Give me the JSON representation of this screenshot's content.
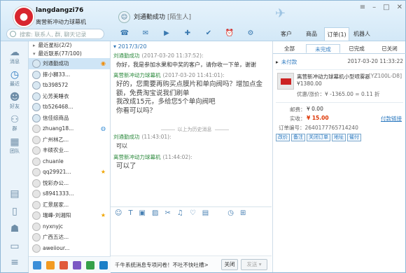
{
  "header": {
    "username": "langdangzi76",
    "shop_name": "离营新冲动力球幕机",
    "search_placeholder": "搜索: 联系人, 群, 聊天记录",
    "contact_name": "刘通勤成功",
    "contact_tag": "[陌生人]",
    "right_tabs": [
      {
        "label": "客户"
      },
      {
        "label": "商品"
      },
      {
        "label": "订单(1)"
      },
      {
        "label": "机器人"
      }
    ]
  },
  "rail": [
    {
      "label": "消息",
      "icon": "message-icon"
    },
    {
      "label": "最近",
      "icon": "clock-icon"
    },
    {
      "label": "好友",
      "icon": "person-icon"
    },
    {
      "label": "群",
      "icon": "group-icon"
    },
    {
      "label": "团队",
      "icon": "team-icon"
    }
  ],
  "contacts": {
    "groups": [
      {
        "label": "最近星标(2/2)"
      },
      {
        "label": "最近联系(77/100)"
      }
    ],
    "items": [
      {
        "name": "刘通勤成功",
        "online": true,
        "selected": true,
        "mark": "warn"
      },
      {
        "name": "摔小狮33...",
        "online": true,
        "mark": ""
      },
      {
        "name": "tb398572",
        "online": true,
        "mark": ""
      },
      {
        "name": "沁芳美睡衣",
        "online": true,
        "mark": ""
      },
      {
        "name": "tb526468...",
        "online": true,
        "mark": ""
      },
      {
        "name": "信佳综商品",
        "online": true,
        "mark": ""
      },
      {
        "name": "zhuang18...",
        "online": false,
        "mark": "globe"
      },
      {
        "name": "广州林乙...",
        "online": false,
        "mark": ""
      },
      {
        "name": "丰硕农业...",
        "online": false,
        "mark": ""
      },
      {
        "name": "chuanle",
        "online": false,
        "mark": ""
      },
      {
        "name": "qq29921...",
        "online": false,
        "mark": "star"
      },
      {
        "name": "悦彩办公...",
        "online": false,
        "mark": ""
      },
      {
        "name": "s8941333...",
        "online": false,
        "mark": ""
      },
      {
        "name": "汇景居家...",
        "online": false,
        "mark": ""
      },
      {
        "name": "瑞峰-刘湘阳",
        "online": false,
        "mark": "star"
      },
      {
        "name": "nyxnyjc",
        "online": false,
        "mark": ""
      },
      {
        "name": "广西五达...",
        "online": false,
        "mark": ""
      },
      {
        "name": "aweiiour...",
        "online": false,
        "mark": ""
      }
    ]
  },
  "chat": {
    "date": "2017/3/20",
    "messages": [
      {
        "sender": "刘通勤成功",
        "time": "(2017-03-20 11:37:52):",
        "role": "buyer",
        "text": "你好，我是参加水果和中奖的客户，请你收一下单，谢谢",
        "big": false
      },
      {
        "sender": "离营新冲动力球幕机",
        "time": "(2017-03-20 11:41:01):",
        "role": "seller",
        "text": "好的，您需要再购买点膜片和单向阀吗？增加点金额，免费淘宝说我们刷单\n我改成15元，多给您5个单向阀吧\n你看可以吗？",
        "big": true
      },
      {
        "sender": "刘通勤成功",
        "time": "(11:43:01):",
        "role": "buyer",
        "text": "可以",
        "big": false
      },
      {
        "sender": "离营新冲动力球幕机",
        "time": "(11:44:02):",
        "role": "seller",
        "text": "可以了",
        "big": true
      }
    ],
    "history_label": "以上为历史消息"
  },
  "input": {
    "tip": "千牛系统消息专项问卷！不吐不快吐槽>",
    "close_label": "关闭",
    "send_label": "发送"
  },
  "order": {
    "tabs": [
      {
        "label": "全部"
      },
      {
        "label": "未完成"
      },
      {
        "label": "已完成"
      },
      {
        "label": "已关闭"
      }
    ],
    "status": "未付款",
    "date": "2017-03-20 11:33:22",
    "product_title": "离营新冲动力球幕机小型喷雾器",
    "sku": "[YZ100L-D8]",
    "price": "¥1380.00",
    "discount": "优惠/涨价：¥ -1365.00 = 0.11 折",
    "postage_label": "邮费：",
    "postage": "¥ 0.00",
    "paid_label": "实收：",
    "paid": "¥ 15.00",
    "link_label": "付款链接",
    "order_no": "订单编号：2640177765714240",
    "actions": [
      "改价",
      "备注",
      "关闭订单",
      "地址",
      "催付"
    ]
  },
  "colors": {
    "accent": "#2d7ac0",
    "price_red": "#d33300",
    "buyer_name": "#2e8b3f"
  }
}
